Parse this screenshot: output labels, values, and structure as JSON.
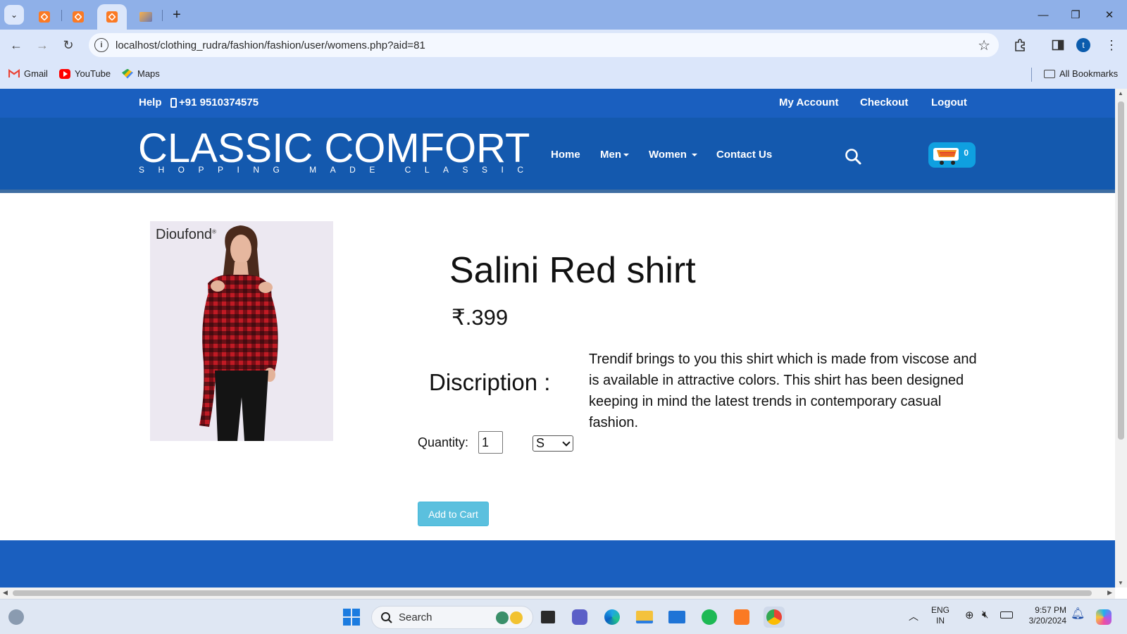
{
  "browser": {
    "tabs": [
      {
        "icon": "xampp-icon"
      },
      {
        "icon": "xampp-icon"
      },
      {
        "icon": "xampp-icon",
        "active": true
      },
      {
        "icon": "phpmyadmin-icon"
      }
    ],
    "url": "localhost/clothing_rudra/fashion/fashion/user/womens.php?aid=81",
    "profile_initial": "t",
    "bookmarks": [
      {
        "label": "Gmail",
        "icon": "gmail-icon"
      },
      {
        "label": "YouTube",
        "icon": "youtube-icon"
      },
      {
        "label": "Maps",
        "icon": "maps-icon"
      }
    ],
    "all_bookmarks": "All Bookmarks"
  },
  "site": {
    "topbar": {
      "help": "Help",
      "phone": "+91 9510374575",
      "account": "My Account",
      "checkout": "Checkout",
      "logout": "Logout"
    },
    "logo": {
      "title": "CLASSIC COMFORT",
      "tagline": "SHOPPING MADE CLASSIC"
    },
    "nav": {
      "home": "Home",
      "men": "Men",
      "women": "Women",
      "contact": "Contact Us"
    },
    "cart_count": "0",
    "colors": {
      "topbar": "#1a5fbf",
      "nav": "#1459ae",
      "button": "#5bc0de",
      "cart": "#0fa0e0"
    }
  },
  "product": {
    "image_brand": "Dioufond",
    "title": "Salini Red shirt",
    "price": "₹.399",
    "description_label": "Discription :",
    "description": "Trendif brings to you this shirt which is made from viscose and is available in attractive colors. This shirt has been designed keeping in mind the latest trends in contemporary casual fashion.",
    "quantity_label": "Quantity:",
    "quantity_value": "1",
    "size_selected": "S",
    "add_to_cart": "Add to Cart"
  },
  "taskbar": {
    "search": "Search",
    "language": "ENG",
    "region": "IN",
    "time": "9:57 PM",
    "date": "3/20/2024"
  }
}
